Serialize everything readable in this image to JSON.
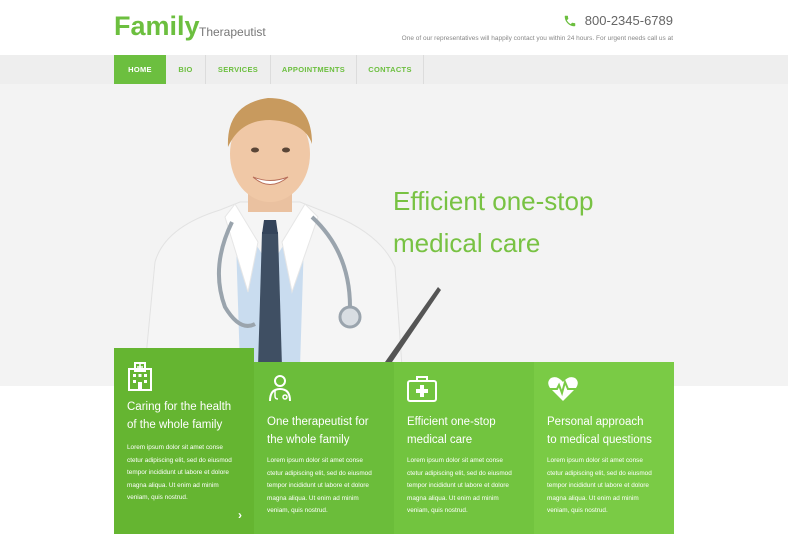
{
  "brand": {
    "name": "Family",
    "tagline": "Therapeutist"
  },
  "contact": {
    "phone": "800-2345-6789",
    "note": "One of our representatives will happily contact you within 24 hours. For urgent needs call us at"
  },
  "nav": {
    "items": [
      {
        "label": "HOME",
        "active": true
      },
      {
        "label": "BIO",
        "active": false
      },
      {
        "label": "SERVICES",
        "active": false
      },
      {
        "label": "APPOINTMENTS",
        "active": false
      },
      {
        "label": "CONTACTS",
        "active": false
      }
    ]
  },
  "hero": {
    "line1": "Efficient one-stop",
    "line2": "medical care"
  },
  "features": [
    {
      "icon": "hospital-icon",
      "title1": "Caring for the health",
      "title2": "of the whole family",
      "text": [
        "Lorem ipsum dolor sit amet conse",
        "ctetur adipiscing elit, sed do eiusmod",
        "tempor incididunt ut labore et dolore",
        "magna aliqua. Ut enim ad minim",
        "veniam, quis nostrud."
      ],
      "arrow": "›"
    },
    {
      "icon": "doctor-icon",
      "title1": "One therapeutist for",
      "title2": "the whole family",
      "text": [
        "Lorem ipsum dolor sit amet conse",
        "ctetur adipiscing elit, sed do eiusmod",
        "tempor incididunt ut labore et dolore",
        "magna aliqua. Ut enim ad minim",
        "veniam, quis nostrud."
      ]
    },
    {
      "icon": "first-aid-kit-icon",
      "title1": "Efficient one-stop",
      "title2": "medical care",
      "text": [
        "Lorem ipsum dolor sit amet conse",
        "ctetur adipiscing elit, sed do eiusmod",
        "tempor incididunt ut labore et dolore",
        "magna aliqua. Ut enim ad minim",
        "veniam, quis nostrud."
      ]
    },
    {
      "icon": "heartbeat-icon",
      "title1": "Personal approach",
      "title2": "to medical questions",
      "text": [
        "Lorem ipsum dolor sit amet conse",
        "ctetur adipiscing elit, sed do eiusmod",
        "tempor incididunt ut labore et dolore",
        "magna aliqua. Ut enim ad minim",
        "veniam, quis nostrud."
      ]
    }
  ],
  "colors": {
    "brand_green": "#6cbf3f",
    "feature_1": "#65b531",
    "feature_2": "#6bbd3a",
    "feature_3": "#72c43f",
    "feature_4": "#7acb45"
  }
}
